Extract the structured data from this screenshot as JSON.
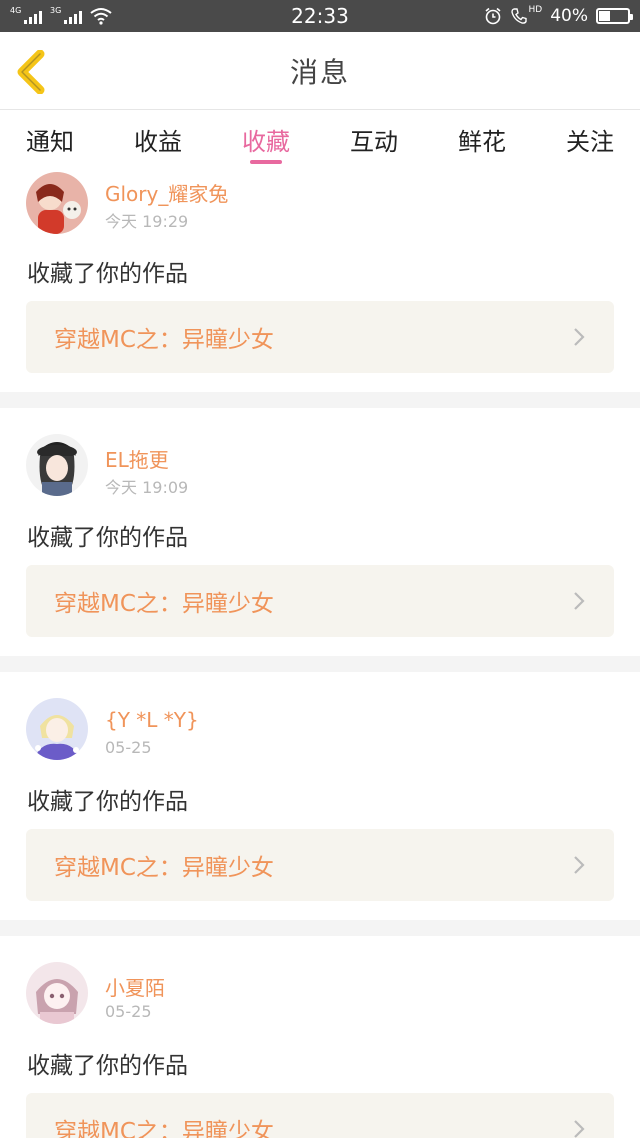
{
  "status_bar": {
    "net1": "4G",
    "net2": "3G",
    "time": "22:33",
    "hd": "HD",
    "battery": "40%",
    "battery_level": 0.4
  },
  "header": {
    "title": "消息"
  },
  "tabs": [
    {
      "label": "通知"
    },
    {
      "label": "收益"
    },
    {
      "label": "收藏",
      "active": true
    },
    {
      "label": "互动"
    },
    {
      "label": "鲜花"
    },
    {
      "label": "关注"
    }
  ],
  "messages": [
    {
      "user": "Glory_耀家兔",
      "time": "今天 19:29",
      "action": "收藏了你的作品",
      "work": "穿越MC之：异瞳少女"
    },
    {
      "user": "EL拖更",
      "time": "今天 19:09",
      "action": "收藏了你的作品",
      "work": "穿越MC之：异瞳少女"
    },
    {
      "user": "{Y *L *Y}",
      "time": "05-25",
      "action": "收藏了你的作品",
      "work": "穿越MC之：异瞳少女"
    },
    {
      "user": "小夏陌",
      "time": "05-25",
      "action": "收藏了你的作品",
      "work": "穿越MC之：异瞳少女"
    }
  ],
  "colors": {
    "accent_pink": "#e8699f",
    "name_orange": "#f0945a",
    "back_yellow": "#f5c518"
  }
}
